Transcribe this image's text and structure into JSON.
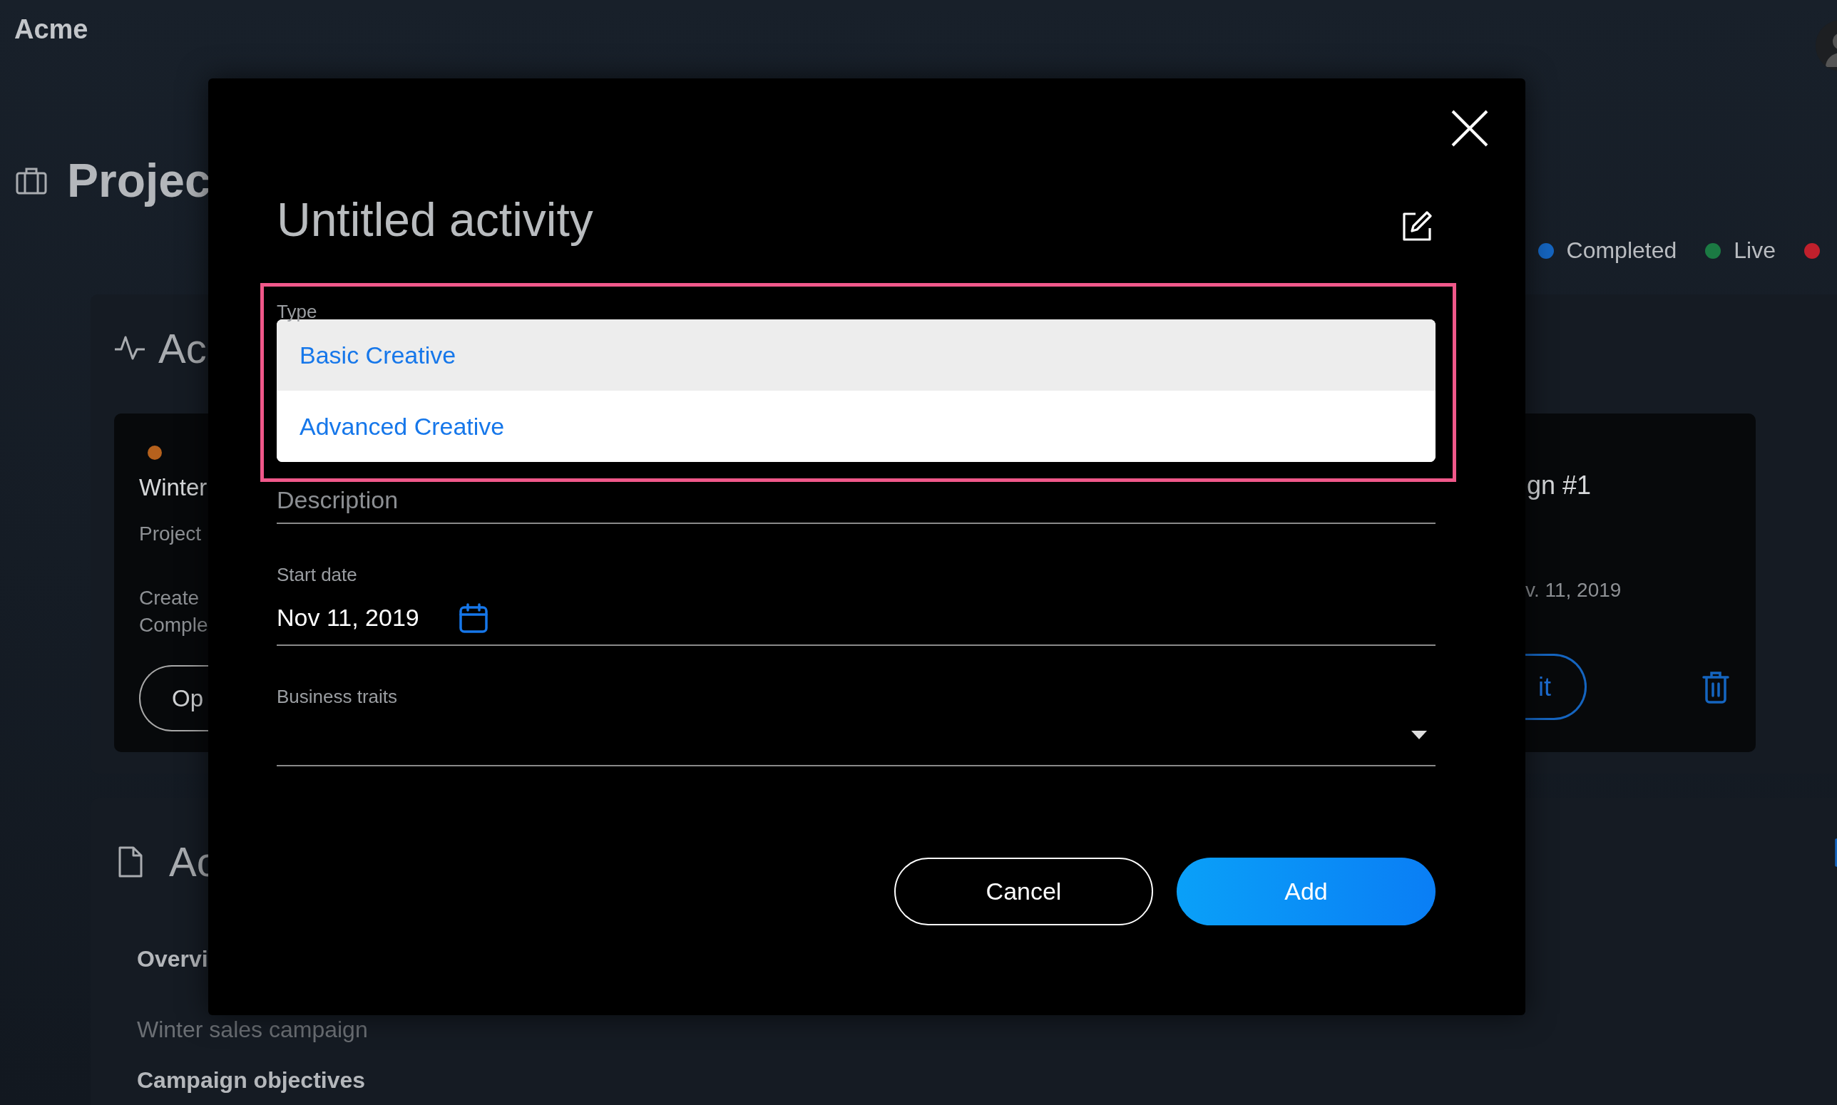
{
  "app": {
    "brand": "Acme"
  },
  "page_title": "Projec",
  "legend": [
    {
      "label": "Completed",
      "color": "#1565c0"
    },
    {
      "label": "Live",
      "color": "#1b7a43"
    },
    {
      "color": "#c0202c"
    }
  ],
  "activities_panel": {
    "heading": "Ac",
    "card": {
      "color": "#b5611d",
      "title": "Winter",
      "subtitle": "Project",
      "meta": [
        "Create",
        "Comple"
      ],
      "open_button": "Op",
      "title_right": "gn #1",
      "date_right": "v. 11, 2019",
      "edit_button": "it"
    }
  },
  "assets_panel": {
    "heading": "Ac",
    "overview_label": "Overvi",
    "overview_text": "Winter sales campaign",
    "objectives_label": "Campaign objectives"
  },
  "modal": {
    "title": "Untitled activity",
    "type_field": {
      "label": "Type",
      "options": [
        {
          "label": "Basic Creative",
          "selected": true
        },
        {
          "label": "Advanced Creative",
          "selected": false
        }
      ]
    },
    "description_field": {
      "label": "Description"
    },
    "start_date_field": {
      "label": "Start date",
      "value": "Nov 11, 2019"
    },
    "business_traits_field": {
      "label": "Business traits"
    },
    "buttons": [
      {
        "label": "Cancel",
        "kind": "secondary"
      },
      {
        "label": "Add",
        "kind": "primary"
      }
    ]
  }
}
